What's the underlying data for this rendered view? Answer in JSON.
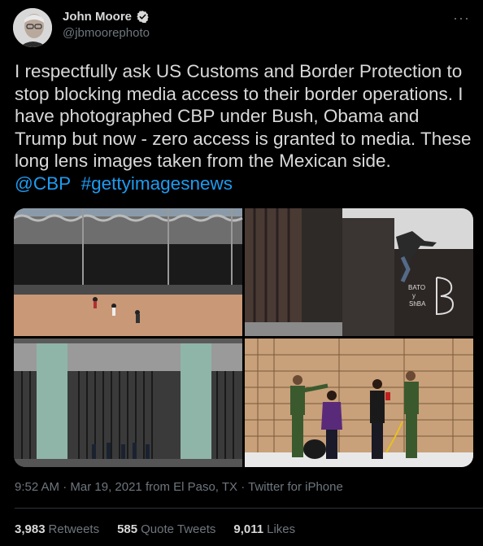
{
  "author": {
    "display_name": "John Moore",
    "handle": "@jbmoorephoto",
    "verified": true,
    "avatar_icon": "avatar-photo"
  },
  "tweet": {
    "text_segments": [
      "I respectfully ask US Customs and Border Protection to stop blocking media access to their border operations. I have photographed CBP under Bush, Obama and Trump but now - zero access is granted to media. These long lens images taken from the Mexican side."
    ],
    "mention": "@CBP",
    "hashtag": "#gettyimagesnews"
  },
  "more_label": "···",
  "meta": {
    "time": "9:52 AM",
    "sep1": " · ",
    "date": "Mar 19, 2021",
    "location": " from El Paso, TX",
    "sep2": " · ",
    "source": "Twitter for iPhone"
  },
  "stats": {
    "retweets_count": "3,983",
    "retweets_label": "Retweets",
    "quotes_count": "585",
    "quotes_label": "Quote Tweets",
    "likes_count": "9,011",
    "likes_label": "Likes"
  },
  "colors": {
    "background": "#000000",
    "text": "#d9d9d9",
    "secondary": "#6e767d",
    "link": "#1d9bf0",
    "verified_badge": "#d9d9d9"
  }
}
